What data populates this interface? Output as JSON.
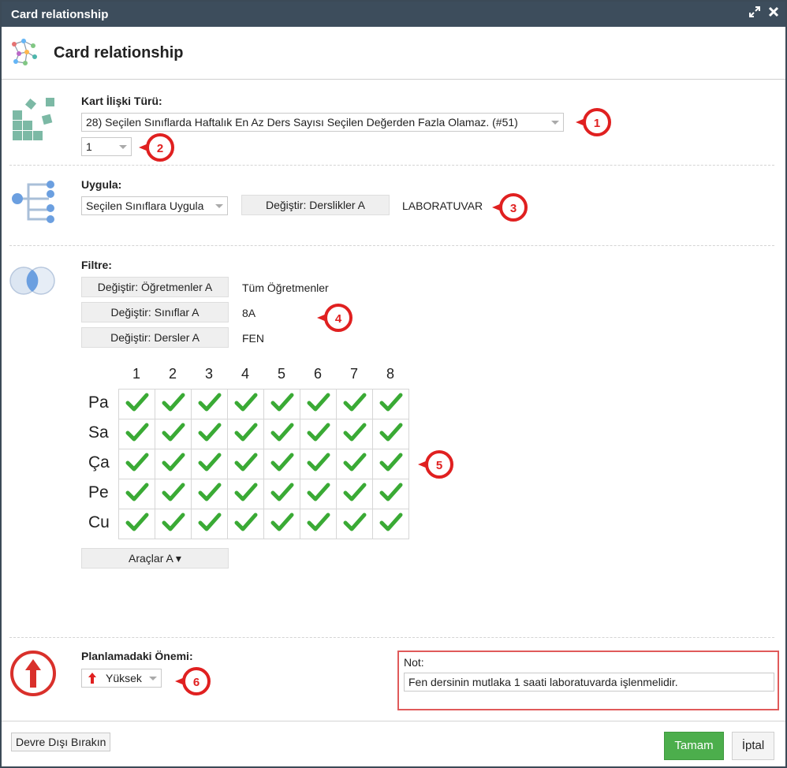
{
  "window": {
    "title": "Card relationship",
    "header_title": "Card relationship"
  },
  "relation_type": {
    "label": "Kart İlişki Türü:",
    "selected": "28) Seçilen Sınıflarda Haftalık En Az Ders Sayısı Seçilen Değerden Fazla Olamaz. (#51)",
    "value_selected": "1"
  },
  "apply": {
    "label": "Uygula:",
    "selected": "Seçilen Sınıflara Uygula",
    "change_button": "Değiştir: Derslikler A",
    "value": "LABORATUVAR"
  },
  "filter": {
    "label": "Filtre:",
    "rows": [
      {
        "button": "Değiştir: Öğretmenler A",
        "value": "Tüm Öğretmenler"
      },
      {
        "button": "Değiştir: Sınıflar A",
        "value": "8A"
      },
      {
        "button": "Değiştir: Dersler A",
        "value": "FEN"
      }
    ]
  },
  "schedule": {
    "columns": [
      "1",
      "2",
      "3",
      "4",
      "5",
      "6",
      "7",
      "8"
    ],
    "rows": [
      "Pa",
      "Sa",
      "Ça",
      "Pe",
      "Cu"
    ],
    "tools_button": "Araçlar A ▾"
  },
  "importance": {
    "label": "Planlamadaki Önemi:",
    "selected": "Yüksek"
  },
  "note": {
    "label": "Not:",
    "value": "Fen dersinin mutlaka 1 saati laboratuvarda işlenmelidir."
  },
  "footer": {
    "disable_button": "Devre Dışı Bırakın",
    "ok_button": "Tamam",
    "cancel_button": "İptal"
  },
  "badges": [
    "1",
    "2",
    "3",
    "4",
    "5",
    "6"
  ],
  "colors": {
    "titlebar": "#3d4d5c",
    "ok": "#4cae4c",
    "badge": "#e02020",
    "check": "#3aaa35"
  }
}
